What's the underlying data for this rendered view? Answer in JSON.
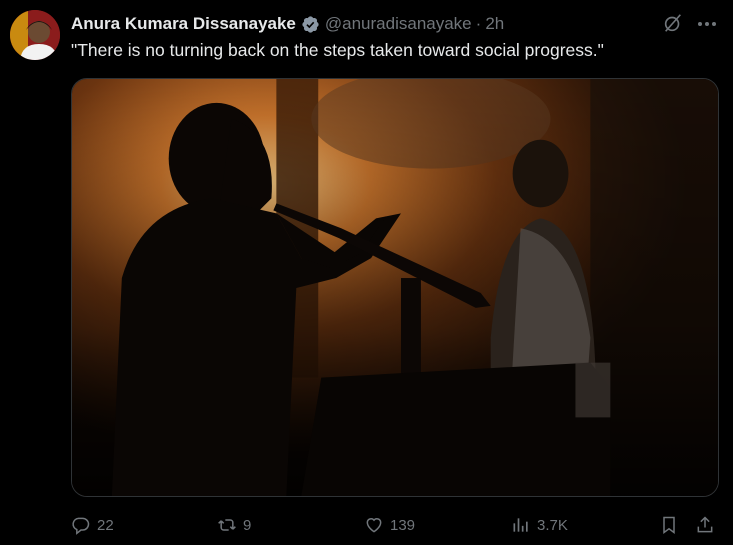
{
  "author": {
    "name": "Anura Kumara Dissanayake",
    "handle": "@anuradisanayake",
    "separator": "·",
    "time": "2h",
    "verified": true
  },
  "tweet": {
    "text": "\"There is no turning back on the steps taken toward social progress.\""
  },
  "icons": {
    "verified": "verified-badge-icon",
    "grok": "grok-icon",
    "more": "more-icon",
    "reply": "reply-icon",
    "retweet": "retweet-icon",
    "like": "heart-icon",
    "views": "views-icon",
    "bookmark": "bookmark-icon",
    "share": "share-icon"
  },
  "actions": {
    "replies": "22",
    "retweets": "9",
    "likes": "139",
    "views": "3.7K"
  },
  "colors": {
    "background": "#000000",
    "text": "#e7e9ea",
    "muted": "#71767b",
    "verified": "#1d9bf0"
  }
}
